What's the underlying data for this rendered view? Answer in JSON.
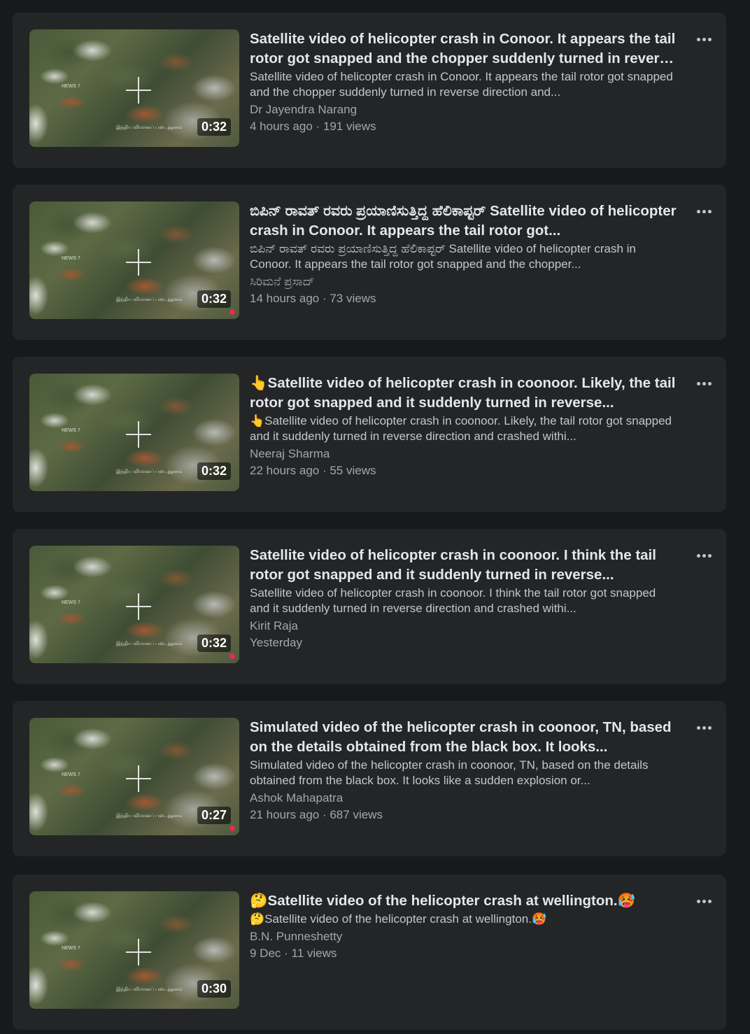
{
  "videos": [
    {
      "title": "Satellite video of helicopter crash in Conoor. It appears the tail rotor got snapped and the chopper suddenly turned in reverse direction and...",
      "description": "Satellite video of helicopter crash in Conoor. It appears the tail rotor got snapped and the chopper suddenly turned in reverse direction and...",
      "author": "Dr Jayendra Narang",
      "meta": "4 hours ago · 191 views",
      "duration": "0:32"
    },
    {
      "title": "ಬಿಪಿನ್ ರಾವತ್ ರವರು ಪ್ರಯಾಣಿಸುತ್ತಿದ್ದ ಹೆಲಿಕಾಪ್ಟರ್ Satellite video of helicopter crash in Conoor. It appears the tail rotor got...",
      "description": "ಬಿಪಿನ್ ರಾವತ್ ರವರು ಪ್ರಯಾಣಿಸುತ್ತಿದ್ದ ಹೆಲಿಕಾಪ್ಟರ್ Satellite video of helicopter crash in Conoor. It appears the tail rotor got snapped and the chopper...",
      "author": "ಸಿರಿಮನೆ ಪ್ರಸಾದ್",
      "meta": "14 hours ago · 73 views",
      "duration": "0:32"
    },
    {
      "title": "👆Satellite video of helicopter crash in coonoor. Likely, the tail rotor got snapped and it suddenly turned in reverse...",
      "description": "👆Satellite video of helicopter crash in coonoor. Likely, the tail rotor got snapped and it suddenly turned in reverse direction and crashed withi...",
      "author": "Neeraj Sharma",
      "meta": "22 hours ago · 55 views",
      "duration": "0:32"
    },
    {
      "title": "Satellite video of helicopter crash in coonoor. I think the tail rotor got snapped and it suddenly turned in reverse...",
      "description": "Satellite video of helicopter crash in coonoor. I think the tail rotor got snapped and it suddenly turned in reverse direction and crashed withi...",
      "author": "Kirit Raja",
      "meta": "Yesterday",
      "duration": "0:32"
    },
    {
      "title": "Simulated video of the helicopter crash in coonoor, TN, based on the details obtained from the black box. It looks...",
      "description": "Simulated video of the helicopter crash in coonoor, TN, based on the details obtained from the black box. It looks like a sudden explosion or...",
      "author": "Ashok Mahapatra",
      "meta": "21 hours ago · 687 views",
      "duration": "0:27"
    },
    {
      "title": "🤔Satellite video of the helicopter crash at wellington.🥵",
      "description": "🤔Satellite video of the helicopter crash at wellington.🥵",
      "author": "B.N. Punneshetty",
      "meta": "9 Dec · 11 views",
      "duration": "0:30"
    }
  ],
  "thumbnail": {
    "channel_tag": "NEWS 7",
    "caption": "இந்திய விமானப் படைத்தளம்"
  }
}
